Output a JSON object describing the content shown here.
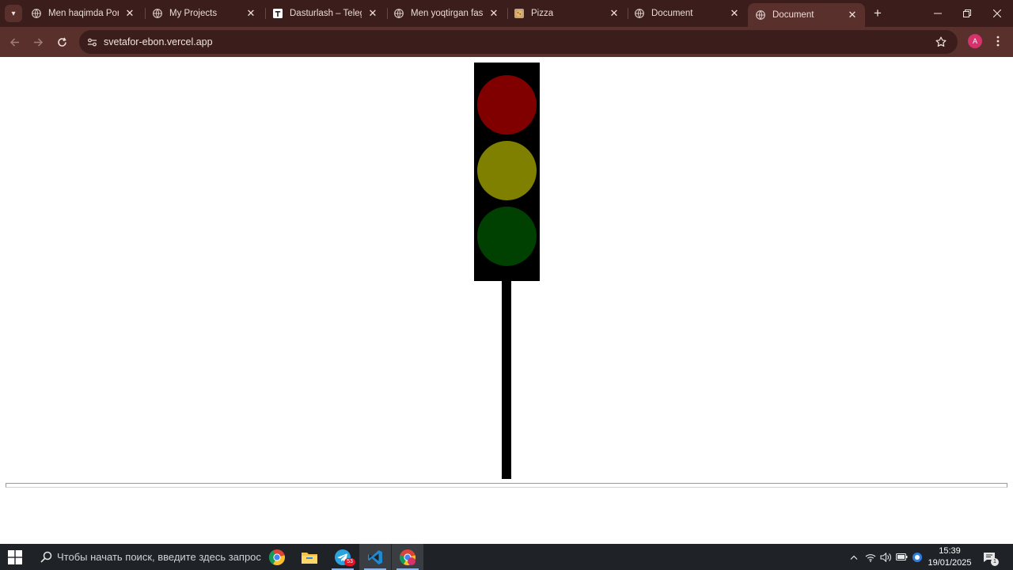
{
  "browser": {
    "tabs": [
      {
        "title": "Men haqimda Portfolio",
        "favicon": "globe-icon",
        "active": false
      },
      {
        "title": "My Projects",
        "favicon": "globe-icon",
        "active": false
      },
      {
        "title": "Dasturlash – Telegraph",
        "favicon": "telegraph-icon",
        "active": false
      },
      {
        "title": "Men yoqtirgan fasl",
        "favicon": "globe-icon",
        "active": false
      },
      {
        "title": "Pizza",
        "favicon": "pizza-icon",
        "active": false
      },
      {
        "title": "Document",
        "favicon": "globe-icon",
        "active": false
      },
      {
        "title": "Document",
        "favicon": "globe-icon",
        "active": true
      }
    ],
    "url": "svetafor-ebon.vercel.app",
    "profile_initial": "A",
    "accent_color": "#5a302c",
    "frame_color": "#3b1d1b"
  },
  "page": {
    "traffic_light": {
      "lamps": [
        {
          "name": "red",
          "color": "#800000"
        },
        {
          "name": "yellow",
          "color": "#808000"
        },
        {
          "name": "green",
          "color": "#004000"
        }
      ],
      "housing_color": "#000000",
      "pole_color": "#000000"
    }
  },
  "taskbar": {
    "search_placeholder": "Чтобы начать поиск, введите здесь запрос",
    "telegram_badge": "53",
    "time": "15:39",
    "date": "19/01/2025",
    "notifications": "1",
    "apps": [
      "chrome-icon",
      "file-explorer-icon",
      "telegram-icon",
      "vscode-icon",
      "chrome-profile-icon"
    ]
  }
}
